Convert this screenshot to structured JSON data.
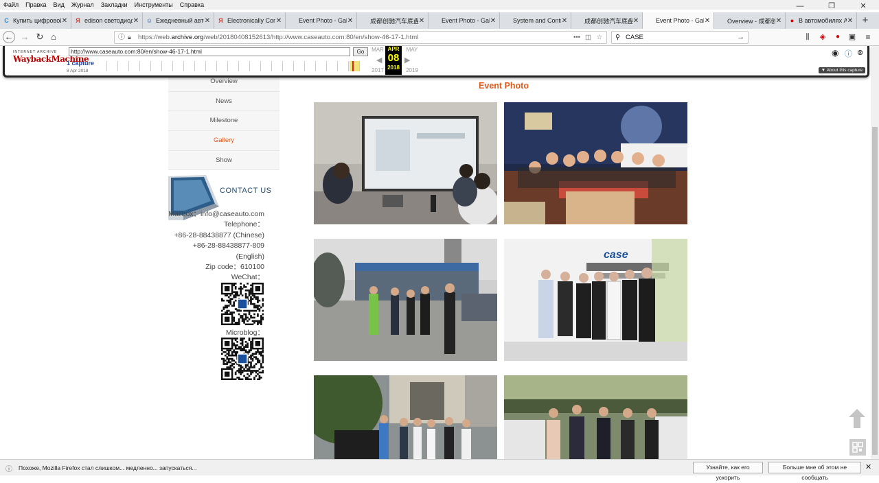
{
  "menubar": {
    "items": [
      "Файл",
      "Правка",
      "Вид",
      "Журнал",
      "Закладки",
      "Инструменты",
      "Справка"
    ]
  },
  "tabs": [
    {
      "label": "Купить цифровой",
      "icon": "c-icon",
      "color": "#1a8fd8",
      "glyph": "C"
    },
    {
      "label": "edison светодиод",
      "icon": "yandex-icon",
      "color": "#e32",
      "glyph": "Я"
    },
    {
      "label": "Ежедневный авто",
      "icon": "person-icon",
      "color": "#2356a8",
      "glyph": "☺"
    },
    {
      "label": "Electronically Con",
      "icon": "yandex-icon",
      "color": "#e32",
      "glyph": "Я"
    },
    {
      "label": "Event Photo - Gallery",
      "icon": "",
      "color": "",
      "glyph": ""
    },
    {
      "label": "成都创驰汽车底盘系统",
      "icon": "",
      "color": "",
      "glyph": ""
    },
    {
      "label": "Event Photo - Gallery",
      "icon": "",
      "color": "",
      "glyph": ""
    },
    {
      "label": "System and Control Te",
      "icon": "",
      "color": "",
      "glyph": ""
    },
    {
      "label": "成都创驰汽车底盘系统",
      "icon": "",
      "color": "",
      "glyph": ""
    },
    {
      "label": "Event Photo - Gallery",
      "icon": "",
      "color": "",
      "glyph": "",
      "active": true
    },
    {
      "label": "Overview - 成都创驰",
      "icon": "",
      "color": "",
      "glyph": ""
    },
    {
      "label": "В автомобилях А",
      "icon": "red-badge-icon",
      "color": "#c00",
      "glyph": "●"
    }
  ],
  "navbar": {
    "url_prefix": "https://web.",
    "url_host": "archive.org",
    "url_rest": "/web/20180408152613/http://www.caseauto.com:80/en/show-46-17-1.html",
    "search_value": "CASE",
    "more_dots": "•••"
  },
  "wayback": {
    "logo_top": "INTERNET ARCHIVE",
    "logo_main": "WaybackMachine",
    "url_value": "http://www.caseauto.com:80/en/show-46-17-1.html",
    "go_label": "Go",
    "captures": "1 capture",
    "capture_date": "8 Apr 2018",
    "prev_month": "MAR",
    "cur_month": "APR",
    "next_month": "MAY",
    "cur_day": "08",
    "prev_year": "2017",
    "cur_year": "2018",
    "next_year": "2019",
    "about": "▼ About this capture"
  },
  "sidebar": {
    "items": [
      {
        "label": "Overview",
        "active": false
      },
      {
        "label": "News",
        "active": false
      },
      {
        "label": "Milestone",
        "active": false
      },
      {
        "label": "Gallery",
        "active": true
      },
      {
        "label": "Show",
        "active": false
      }
    ]
  },
  "contact": {
    "title": "CONTACT US",
    "lines": [
      "Mailbox：info@caseauto.com",
      "Telephone：",
      "+86-28-88438877 (Chinese)",
      "+86-28-88438877-809",
      "(English)",
      "Zip code：610100",
      "WeChat："
    ],
    "microblog": "Microblog："
  },
  "main": {
    "title": "Event Photo"
  },
  "notification": {
    "message": "Похоже, Mozilla Firefox стал слишком... медленно... запускаться...",
    "button1": "Узнайте, как его ускорить",
    "button2": "Больше мне об этом не сообщать"
  },
  "colors": {
    "accent": "#e05a1c",
    "contact_title": "#1f4a70",
    "wayback_highlight": "#ffff00"
  }
}
